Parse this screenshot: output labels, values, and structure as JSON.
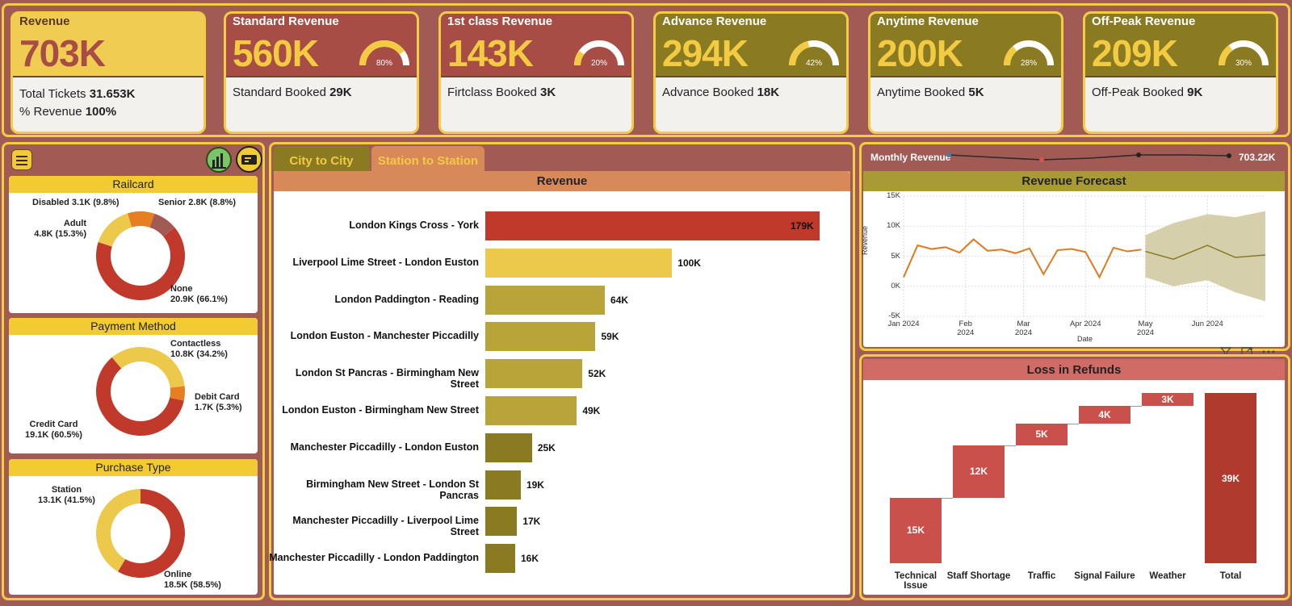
{
  "kpis": [
    {
      "title": "Revenue",
      "value": "703K",
      "line1_label": "Total Tickets ",
      "line1_value": "31.653K",
      "line2_label": "% Revenue ",
      "line2_value": "100%"
    },
    {
      "title": "Standard Revenue",
      "value": "560K",
      "booked_label": "Standard Booked ",
      "booked_value": "29K",
      "gauge_pct": "80%",
      "gauge_fraction": 0.8
    },
    {
      "title": "1st class Revenue",
      "value": "143K",
      "booked_label": "Firtclass Booked ",
      "booked_value": "3K",
      "gauge_pct": "20%",
      "gauge_fraction": 0.2
    },
    {
      "title": "Advance Revenue",
      "value": "294K",
      "booked_label": "Advance Booked ",
      "booked_value": "18K",
      "gauge_pct": "42%",
      "gauge_fraction": 0.42
    },
    {
      "title": "Anytime Revenue",
      "value": "200K",
      "booked_label": "Anytime Booked ",
      "booked_value": "5K",
      "gauge_pct": "28%",
      "gauge_fraction": 0.28
    },
    {
      "title": "Off-Peak Revenue",
      "value": "209K",
      "booked_label": "Off-Peak Booked ",
      "booked_value": "9K",
      "gauge_pct": "30%",
      "gauge_fraction": 0.3
    }
  ],
  "colors": {
    "background": "#a25a55",
    "accent_yellow": "#f2cb42",
    "olive": "#8a7a21",
    "red": "#a84c46",
    "bar_red": "#c0392b"
  },
  "left_panel": {
    "menu_icon": "hamburger-menu-icon",
    "icon1": "chart-analytics-icon",
    "icon2": "ticket-icon",
    "railcard": {
      "title": "Railcard",
      "labels": [
        {
          "name": "Disabled",
          "text": "Disabled 3.1K (9.8%)"
        },
        {
          "name": "Senior",
          "text": "Senior 2.8K (8.8%)"
        },
        {
          "name": "Adult",
          "line1": "Adult",
          "line2": "4.8K (15.3%)"
        },
        {
          "name": "None",
          "line1": "None",
          "line2": "20.9K (66.1%)"
        }
      ]
    },
    "payment": {
      "title": "Payment Method",
      "contactless": {
        "line1": "Contactless",
        "line2": "10.8K (34.2%)"
      },
      "debit": {
        "line1": "Debit Card",
        "line2": "1.7K (5.3%)"
      },
      "credit": {
        "line1": "Credit Card",
        "line2": "19.1K (60.5%)"
      }
    },
    "purchase": {
      "title": "Purchase Type",
      "station": {
        "line1": "Station",
        "line2": "13.1K (41.5%)"
      },
      "online": {
        "line1": "Online",
        "line2": "18.5K (58.5%)"
      }
    }
  },
  "tabs": {
    "city": "City to City",
    "station": "Station to Station"
  },
  "center": {
    "title": "Revenue"
  },
  "monthly": {
    "label": "Monthly Revenue",
    "value": "703.22K"
  },
  "forecast": {
    "title": "Revenue Forecast",
    "ylabel": "Revenue",
    "xlabel": "Date",
    "yticks": [
      "15K",
      "10K",
      "5K",
      "0K",
      "-5K"
    ],
    "xticks": [
      "Jan 2024",
      "Feb 2024",
      "Mar 2024",
      "Apr 2024",
      "May 2024",
      "Jun 2024"
    ]
  },
  "refunds": {
    "title": "Loss in Refunds"
  },
  "chart_data": [
    {
      "type": "bar",
      "title": "Revenue",
      "categories": [
        "London Kings Cross - York",
        "Liverpool Lime Street - London Euston",
        "London Paddington - Reading",
        "London Euston - Manchester Piccadilly",
        "London St Pancras - Birmingham New Street",
        "London Euston - Birmingham New Street",
        "Manchester Piccadilly - London Euston",
        "Birmingham New Street - London St Pancras",
        "Manchester Piccadilly - Liverpool Lime Street",
        "Manchester Piccadilly - London Paddington"
      ],
      "values": [
        179,
        100,
        64,
        59,
        52,
        49,
        25,
        19,
        17,
        16
      ],
      "value_labels": [
        "179K",
        "100K",
        "64K",
        "59K",
        "52K",
        "49K",
        "25K",
        "19K",
        "17K",
        "16K"
      ]
    },
    {
      "type": "area",
      "title": "Revenue Forecast",
      "ylim": [
        -5000,
        15000
      ],
      "series": [
        {
          "name": "",
          "x": [
            "2024-01-01",
            "2024-01-08",
            "2024-01-15",
            "2024-01-22",
            "2024-01-29",
            "2024-02-05",
            "2024-02-12",
            "2024-02-19",
            "2024-02-26",
            "2024-03-04",
            "2024-03-11",
            "2024-03-18",
            "2024-03-25",
            "2024-04-01",
            "2024-04-08",
            "2024-04-15",
            "2024-04-22",
            "2024-04-29"
          ],
          "values": [
            1500,
            6800,
            6200,
            6500,
            5600,
            7800,
            5900,
            6100,
            5500,
            6300,
            2000,
            6000,
            6200,
            5700,
            1500,
            6400,
            5800,
            6100
          ]
        },
        {
          "name": "",
          "x": [
            "2024-05-01",
            "2024-05-15",
            "2024-06-01",
            "2024-06-15",
            "2024-06-30"
          ],
          "values": [
            5800,
            4500,
            6800,
            4800,
            5200
          ],
          "lower": [
            1500,
            0,
            1000,
            -1000,
            -2500
          ],
          "upper": [
            8500,
            10500,
            12000,
            11500,
            12500
          ]
        }
      ]
    },
    {
      "type": "bar",
      "title": "Loss in Refunds",
      "categories": [
        "Technical Issue",
        "Staff Shortage",
        "Traffic",
        "Signal Failure",
        "Weather",
        "Total"
      ],
      "values": [
        15,
        12,
        5,
        4,
        3,
        39
      ],
      "value_labels": [
        "15K",
        "12K",
        "5K",
        "4K",
        "3K",
        "39K"
      ]
    },
    {
      "type": "pie",
      "title": "Railcard",
      "categories": [
        "None",
        "Adult",
        "Disabled",
        "Senior"
      ],
      "values": [
        66.1,
        15.3,
        9.8,
        8.8
      ]
    },
    {
      "type": "pie",
      "title": "Payment Method",
      "categories": [
        "Contactless",
        "Debit Card",
        "Credit Card"
      ],
      "values": [
        34.2,
        5.3,
        60.5
      ]
    },
    {
      "type": "pie",
      "title": "Purchase Type",
      "categories": [
        "Online",
        "Station"
      ],
      "values": [
        58.5,
        41.5
      ]
    }
  ]
}
